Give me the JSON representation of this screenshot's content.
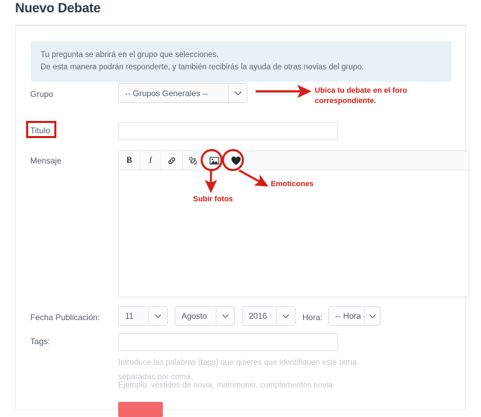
{
  "page": {
    "title": "Nuevo Debate"
  },
  "info_banner": {
    "line1": "Tu pregunta se abrirá en el grupo que selecciones.",
    "line2": "De esta manera podrán responderte, y también recibirás la ayuda de otras novias del grupo."
  },
  "form": {
    "grupo": {
      "label": "Grupo",
      "selected": "-- Grupos Generales --"
    },
    "titulo": {
      "label": "Titulo",
      "value": "",
      "placeholder": ""
    },
    "mensaje": {
      "label": "Mensaje",
      "value": "",
      "toolbar": [
        {
          "name": "bold-icon",
          "label": "B"
        },
        {
          "name": "italic-icon",
          "label": "I"
        },
        {
          "name": "link-icon",
          "label": ""
        },
        {
          "name": "unlink-icon",
          "label": ""
        },
        {
          "name": "image-icon",
          "label": ""
        },
        {
          "name": "heart-icon",
          "label": ""
        }
      ]
    },
    "fecha": {
      "label": "Fecha Publicación:",
      "day": "11",
      "month": "Agosto",
      "year": "2016"
    },
    "hora": {
      "label": "Hora:",
      "selected": "-- Hora --"
    },
    "tags": {
      "label": "Tags:",
      "value": "",
      "help_line1": "Introduce las palabras (tags) que quieres que identifiquen este tema",
      "help_line2": "separadas por coma.",
      "help_line3": "Ejemplo: vestidos de novia, matrimonio, complementos novia"
    },
    "submit": {
      "label": ""
    }
  },
  "annotations": {
    "grupo_note_line1": "Ubica tu debate en el foro",
    "grupo_note_line2": "correspondiente.",
    "subir_fotos": "Subir fotos",
    "emoticones": "Emoticones",
    "color": "#d31f16"
  }
}
